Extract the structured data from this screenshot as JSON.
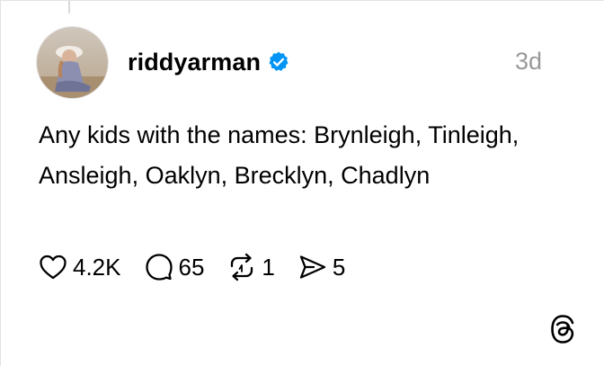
{
  "post": {
    "username": "riddyarman",
    "verified": true,
    "time": "3d",
    "text": "Any kids with the names: Brynleigh, Tinleigh, Ansleigh, Oaklyn, Brecklyn, Chadlyn"
  },
  "actions": {
    "likes": "4.2K",
    "replies": "65",
    "reposts": "1",
    "shares": "5"
  },
  "colors": {
    "verified_badge": "#0095f6",
    "timestamp": "#999999"
  },
  "icons": [
    "heart-icon",
    "comment-icon",
    "repost-icon",
    "share-icon",
    "threads-logo-icon",
    "verified-badge-icon"
  ]
}
